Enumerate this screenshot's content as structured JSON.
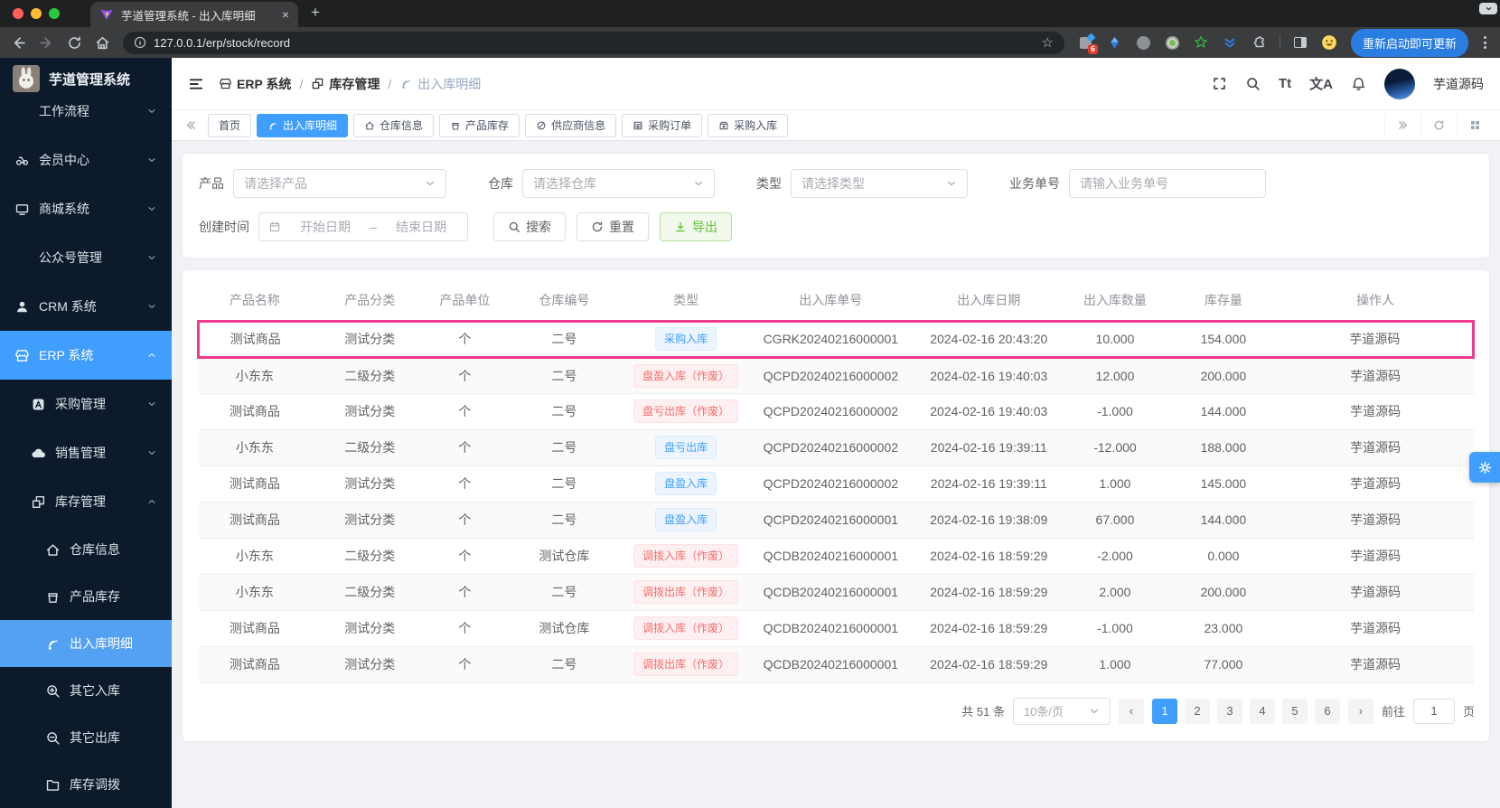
{
  "browser": {
    "tab_title": "芋道管理系统 - 出入库明细",
    "url": "127.0.0.1/erp/stock/record",
    "ext_badge": "6",
    "update_button": "重新启动即可更新"
  },
  "sidebar": {
    "app_title": "芋道管理系统",
    "menu": [
      {
        "key": "workflow",
        "label": "工作流程",
        "icon": "",
        "level": 1,
        "chevron": "down"
      },
      {
        "key": "member-center",
        "label": "会员中心",
        "icon": "member",
        "level": 1,
        "chevron": "down"
      },
      {
        "key": "mall-system",
        "label": "商城系统",
        "icon": "mall",
        "level": 1,
        "chevron": "down"
      },
      {
        "key": "mp-admin",
        "label": "公众号管理",
        "icon": "",
        "level": 1,
        "chevron": "down"
      },
      {
        "key": "crm-system",
        "label": "CRM 系统",
        "icon": "user",
        "level": 1,
        "chevron": "down"
      },
      {
        "key": "erp-system",
        "label": "ERP 系统",
        "icon": "shop",
        "level": 1,
        "chevron": "up",
        "active": "main"
      },
      {
        "key": "purchase-admin",
        "label": "采购管理",
        "icon": "purchase",
        "level": 2,
        "chevron": "down"
      },
      {
        "key": "sales-admin",
        "label": "销售管理",
        "icon": "cloud",
        "level": 2,
        "chevron": "down"
      },
      {
        "key": "stock-admin",
        "label": "库存管理",
        "icon": "boxes",
        "level": 2,
        "chevron": "up"
      },
      {
        "key": "warehouse-info",
        "label": "仓库信息",
        "icon": "house",
        "level": 3
      },
      {
        "key": "product-stock",
        "label": "产品库存",
        "icon": "bucket",
        "level": 3
      },
      {
        "key": "stock-record",
        "label": "出入库明细",
        "icon": "signal",
        "level": 3,
        "active": "sub"
      },
      {
        "key": "other-in",
        "label": "其它入库",
        "icon": "zoomin",
        "level": 3
      },
      {
        "key": "other-out",
        "label": "其它出库",
        "icon": "zoomout",
        "level": 3
      },
      {
        "key": "stock-move",
        "label": "库存调拨",
        "icon": "folder",
        "level": 3
      }
    ]
  },
  "header": {
    "breadcrumb": [
      {
        "icon": "shop",
        "label": "ERP 系统"
      },
      {
        "icon": "boxes",
        "label": "库存管理"
      },
      {
        "icon": "signal",
        "label": "出入库明细",
        "current": true
      }
    ],
    "font_icon_label": "Tt",
    "locale_icon_label": "文A",
    "username": "芋道源码"
  },
  "tags": [
    {
      "key": "home",
      "label": "首页",
      "icon": ""
    },
    {
      "key": "stock-record",
      "label": "出入库明细",
      "icon": "signal",
      "active": true
    },
    {
      "key": "warehouse-info",
      "label": "仓库信息",
      "icon": "house"
    },
    {
      "key": "product-stock",
      "label": "产品库存",
      "icon": "bucket"
    },
    {
      "key": "supplier-info",
      "label": "供应商信息",
      "icon": "supplier"
    },
    {
      "key": "purchase-order",
      "label": "采购订单",
      "icon": "griddoc"
    },
    {
      "key": "purchase-in",
      "label": "采购入库",
      "icon": "purchasein"
    }
  ],
  "filters": {
    "product_label": "产品",
    "product_placeholder": "请选择产品",
    "warehouse_label": "仓库",
    "warehouse_placeholder": "请选择仓库",
    "type_label": "类型",
    "type_placeholder": "请选择类型",
    "bizno_label": "业务单号",
    "bizno_placeholder": "请输入业务单号",
    "date_label": "创建时间",
    "date_start_placeholder": "开始日期",
    "date_separator": "–",
    "date_end_placeholder": "结束日期",
    "search_button": "搜索",
    "reset_button": "重置",
    "export_button": "导出"
  },
  "table": {
    "headers": [
      "产品名称",
      "产品分类",
      "产品单位",
      "仓库编号",
      "类型",
      "出入库单号",
      "出入库日期",
      "出入库数量",
      "库存量",
      "操作人"
    ],
    "rows": [
      {
        "product": "测试商品",
        "category": "测试分类",
        "unit": "个",
        "warehouse": "二号",
        "type": "采购入库",
        "type_style": "blue",
        "order": "CGRK20240216000001",
        "date": "2024-02-16 20:43:20",
        "qty": "10.000",
        "stock": "154.000",
        "operator": "芋道源码",
        "highlight": true
      },
      {
        "product": "小东东",
        "category": "二级分类",
        "unit": "个",
        "warehouse": "二号",
        "type": "盘盈入库（作废）",
        "type_style": "red",
        "order": "QCPD20240216000002",
        "date": "2024-02-16 19:40:03",
        "qty": "12.000",
        "stock": "200.000",
        "operator": "芋道源码"
      },
      {
        "product": "测试商品",
        "category": "测试分类",
        "unit": "个",
        "warehouse": "二号",
        "type": "盘亏出库（作废）",
        "type_style": "red",
        "order": "QCPD20240216000002",
        "date": "2024-02-16 19:40:03",
        "qty": "-1.000",
        "stock": "144.000",
        "operator": "芋道源码"
      },
      {
        "product": "小东东",
        "category": "二级分类",
        "unit": "个",
        "warehouse": "二号",
        "type": "盘亏出库",
        "type_style": "blue",
        "order": "QCPD20240216000002",
        "date": "2024-02-16 19:39:11",
        "qty": "-12.000",
        "stock": "188.000",
        "operator": "芋道源码"
      },
      {
        "product": "测试商品",
        "category": "测试分类",
        "unit": "个",
        "warehouse": "二号",
        "type": "盘盈入库",
        "type_style": "blue",
        "order": "QCPD20240216000002",
        "date": "2024-02-16 19:39:11",
        "qty": "1.000",
        "stock": "145.000",
        "operator": "芋道源码"
      },
      {
        "product": "测试商品",
        "category": "测试分类",
        "unit": "个",
        "warehouse": "二号",
        "type": "盘盈入库",
        "type_style": "blue",
        "order": "QCPD20240216000001",
        "date": "2024-02-16 19:38:09",
        "qty": "67.000",
        "stock": "144.000",
        "operator": "芋道源码"
      },
      {
        "product": "小东东",
        "category": "二级分类",
        "unit": "个",
        "warehouse": "测试仓库",
        "type": "调拨入库（作废）",
        "type_style": "red",
        "order": "QCDB20240216000001",
        "date": "2024-02-16 18:59:29",
        "qty": "-2.000",
        "stock": "0.000",
        "operator": "芋道源码"
      },
      {
        "product": "小东东",
        "category": "二级分类",
        "unit": "个",
        "warehouse": "二号",
        "type": "调拨出库（作废）",
        "type_style": "red",
        "order": "QCDB20240216000001",
        "date": "2024-02-16 18:59:29",
        "qty": "2.000",
        "stock": "200.000",
        "operator": "芋道源码"
      },
      {
        "product": "测试商品",
        "category": "测试分类",
        "unit": "个",
        "warehouse": "测试仓库",
        "type": "调拨入库（作废）",
        "type_style": "red",
        "order": "QCDB20240216000001",
        "date": "2024-02-16 18:59:29",
        "qty": "-1.000",
        "stock": "23.000",
        "operator": "芋道源码"
      },
      {
        "product": "测试商品",
        "category": "测试分类",
        "unit": "个",
        "warehouse": "二号",
        "type": "调拨出库（作废）",
        "type_style": "red",
        "order": "QCDB20240216000001",
        "date": "2024-02-16 18:59:29",
        "qty": "1.000",
        "stock": "77.000",
        "operator": "芋道源码"
      }
    ]
  },
  "pagination": {
    "total": "共 51 条",
    "page_size": "10条/页",
    "prev": "‹",
    "next": "›",
    "pages": [
      "1",
      "2",
      "3",
      "4",
      "5",
      "6"
    ],
    "active_page": "1",
    "goto_label": "前往",
    "goto_value": "1",
    "page_unit": "页"
  },
  "colors": {
    "accent": "#409eff",
    "row_highlight": "#ee3a8c",
    "success": "#67c23a",
    "danger": "#f56c6c",
    "sidebar_bg": "#0d1a2b"
  }
}
